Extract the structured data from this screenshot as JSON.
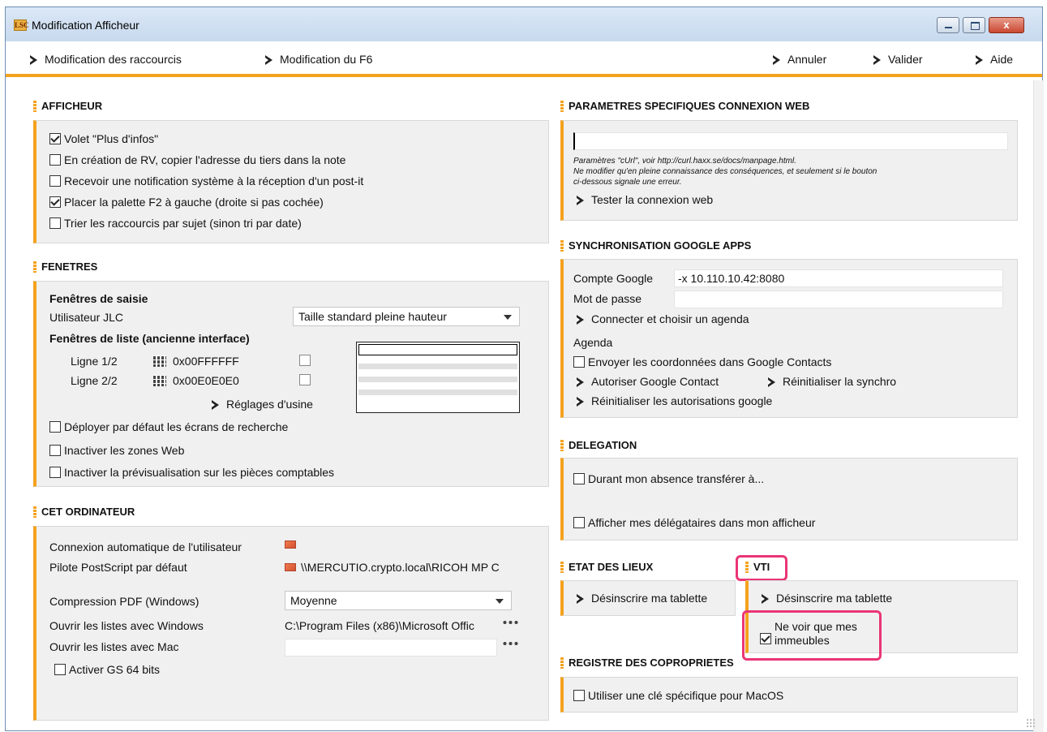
{
  "window": {
    "app_icon": "LSC",
    "title": "Modification Afficheur",
    "close_label": "x"
  },
  "menubar": {
    "left": [
      "Modification des raccourcis",
      "Modification du F6"
    ],
    "right": [
      "Annuler",
      "Valider",
      "Aide"
    ]
  },
  "afficheur": {
    "title": "AFFICHEUR",
    "options": [
      {
        "label": "Volet \"Plus d'infos\"",
        "checked": true
      },
      {
        "label": "En création de RV, copier l'adresse du tiers dans la note",
        "checked": false
      },
      {
        "label": "Recevoir une notification système à la réception d'un post-it",
        "checked": false
      },
      {
        "label": "Placer la palette F2 à gauche (droite si pas cochée)",
        "checked": true
      },
      {
        "label": "Trier les raccourcis par sujet (sinon tri par date)",
        "checked": false
      }
    ]
  },
  "fenetres": {
    "title": "FENETRES",
    "saisie_heading": "Fenêtres de saisie",
    "utilisateur_label": "Utilisateur JLC",
    "utilisateur_value": "Taille standard pleine hauteur",
    "liste_heading": "Fenêtres de liste (ancienne interface)",
    "ligne1_label": "Ligne 1/2",
    "ligne1_color": "0x00FFFFFF",
    "ligne2_label": "Ligne 2/2",
    "ligne2_color": "0x00E0E0E0",
    "reglages": "Réglages d'usine",
    "options": [
      {
        "label": "Déployer par défaut les écrans de recherche",
        "checked": false
      },
      {
        "label": "Inactiver les zones Web",
        "checked": false
      },
      {
        "label": "Inactiver la prévisualisation sur les pièces comptables",
        "checked": false
      }
    ]
  },
  "ordinateur": {
    "title": "CET ORDINATEUR",
    "auto_login_label": "Connexion automatique de l'utilisateur",
    "postscript_label": "Pilote PostScript par défaut",
    "postscript_value": "\\\\MERCUTIO.crypto.local\\RICOH MP C",
    "pdf_label": "Compression PDF (Windows)",
    "pdf_value": "Moyenne",
    "windows_label": "Ouvrir les listes avec Windows",
    "windows_value": "C:\\Program Files (x86)\\Microsoft Offic",
    "mac_label": "Ouvrir les listes avec Mac",
    "mac_value": "",
    "gs64_label": "Activer GS 64 bits"
  },
  "web": {
    "title": "PARAMETRES SPECIFIQUES CONNEXION WEB",
    "input_value": "",
    "note1": "Paramètres \"cUrl\", voir http://curl.haxx.se/docs/manpage.html.",
    "note2": "Ne modifier qu'en pleine connaissance des conséquences, et seulement si le bouton",
    "note3": "ci-dessous signale une erreur.",
    "test_label": "Tester la connexion web"
  },
  "google": {
    "title": "SYNCHRONISATION GOOGLE APPS",
    "account_label": "Compte Google",
    "account_value": "-x 10.110.10.42:8080",
    "password_label": "Mot de passe",
    "connect_label": "Connecter et choisir un agenda",
    "agenda_label": "Agenda",
    "send_contacts_label": "Envoyer les coordonnées dans Google Contacts",
    "authorize_label": "Autoriser Google Contact",
    "reset_sync_label": "Réinitialiser la synchro",
    "reset_auth_label": "Réinitialiser les autorisations google"
  },
  "delegation": {
    "title": "DELEGATION",
    "transfer_label": "Durant mon absence transférer à...",
    "show_label": "Afficher mes délégataires dans mon afficheur"
  },
  "etat": {
    "title": "ETAT DES LIEUX",
    "unregister_label": "Désinscrire ma tablette"
  },
  "vti": {
    "title": "VTI",
    "unregister_label": "Désinscrire ma tablette",
    "only_buildings_line1": "Ne voir que mes",
    "only_buildings_line2": "immeubles"
  },
  "registre": {
    "title": "REGISTRE DES COPROPRIETES",
    "macos_label": "Utiliser une clé spécifique pour MacOS"
  },
  "colors": {
    "accent": "#f4a21e",
    "highlight": "#ea3576",
    "panel_bg": "#f0f0f0"
  }
}
